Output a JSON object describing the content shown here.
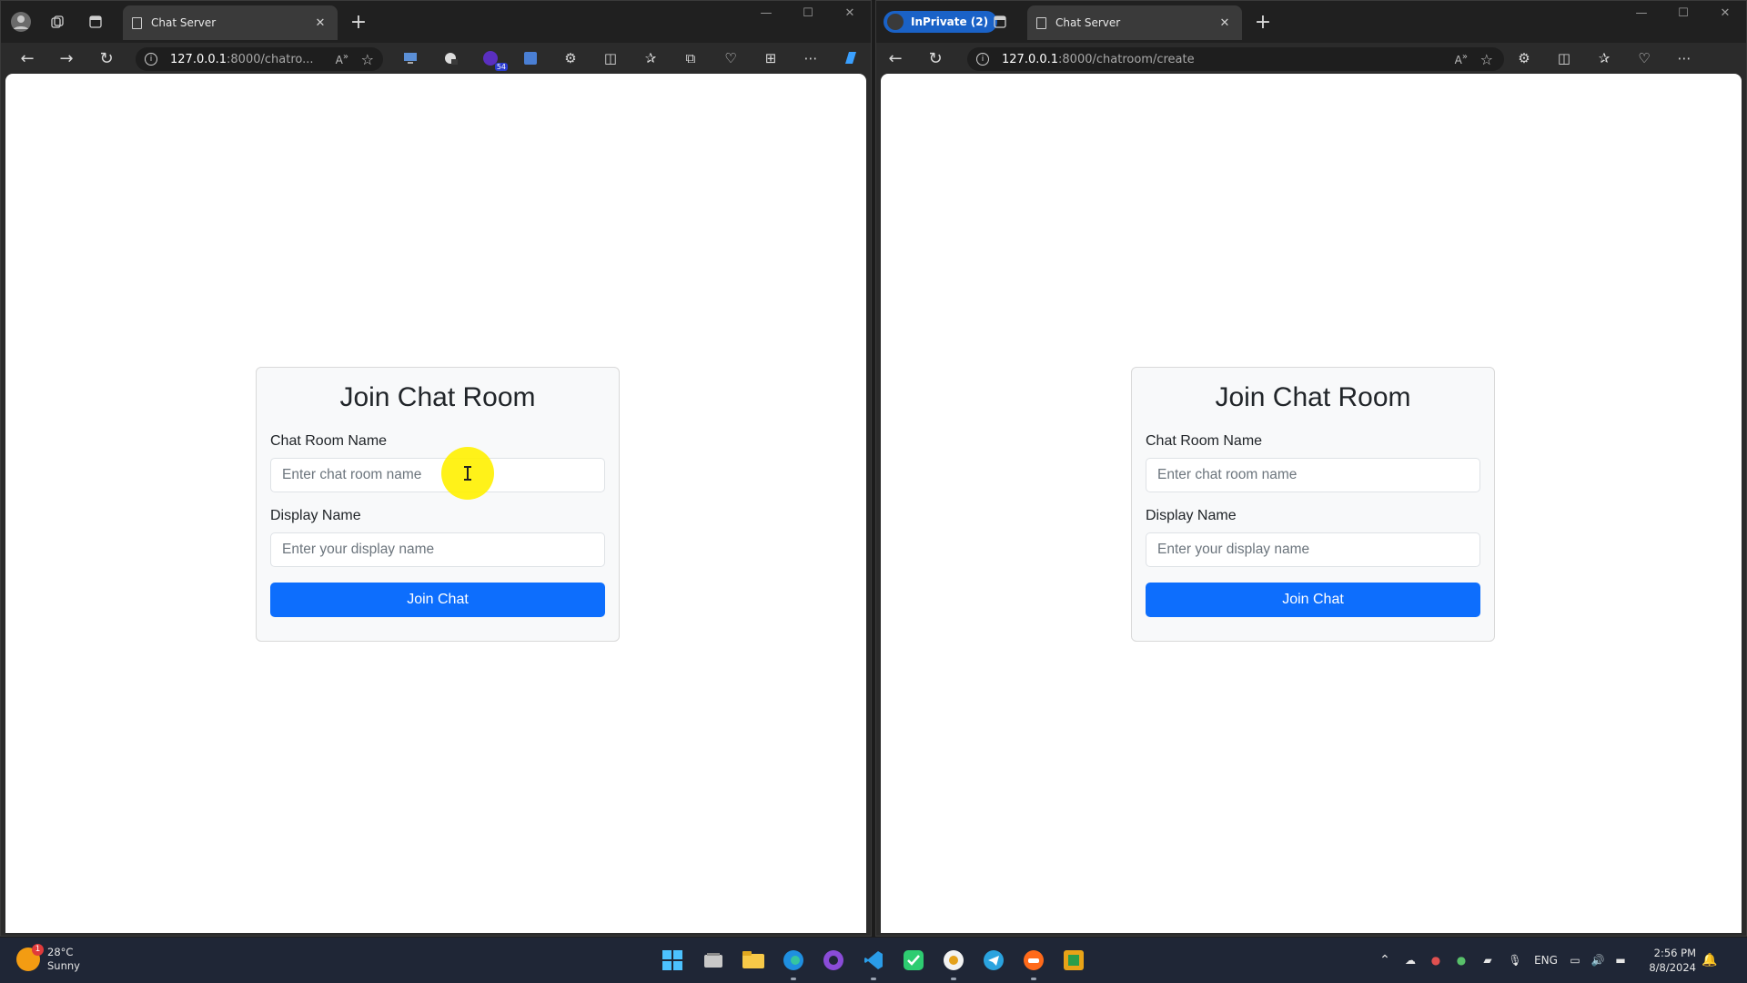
{
  "left_window": {
    "tab_title": "Chat Server",
    "url_host": "127.0.0.1",
    "url_rest": ":8000/chatro...",
    "extension_badge": "54"
  },
  "right_window": {
    "inprivate_label": "InPrivate (2)",
    "tab_title": "Chat Server",
    "url_host": "127.0.0.1",
    "url_rest": ":8000/chatroom/create"
  },
  "form": {
    "heading": "Join Chat Room",
    "room_label": "Chat Room Name",
    "room_placeholder": "Enter chat room name",
    "display_label": "Display Name",
    "display_placeholder": "Enter your display name",
    "submit_label": "Join Chat"
  },
  "taskbar": {
    "weather_temp": "28°C",
    "weather_desc": "Sunny",
    "weather_badge": "1",
    "language": "ENG",
    "time": "2:56 PM",
    "date": "8/8/2024"
  },
  "colors": {
    "primary_button": "#0d6efd",
    "inprivate_badge": "#1a62c7",
    "cursor_highlight": "#fff100"
  }
}
